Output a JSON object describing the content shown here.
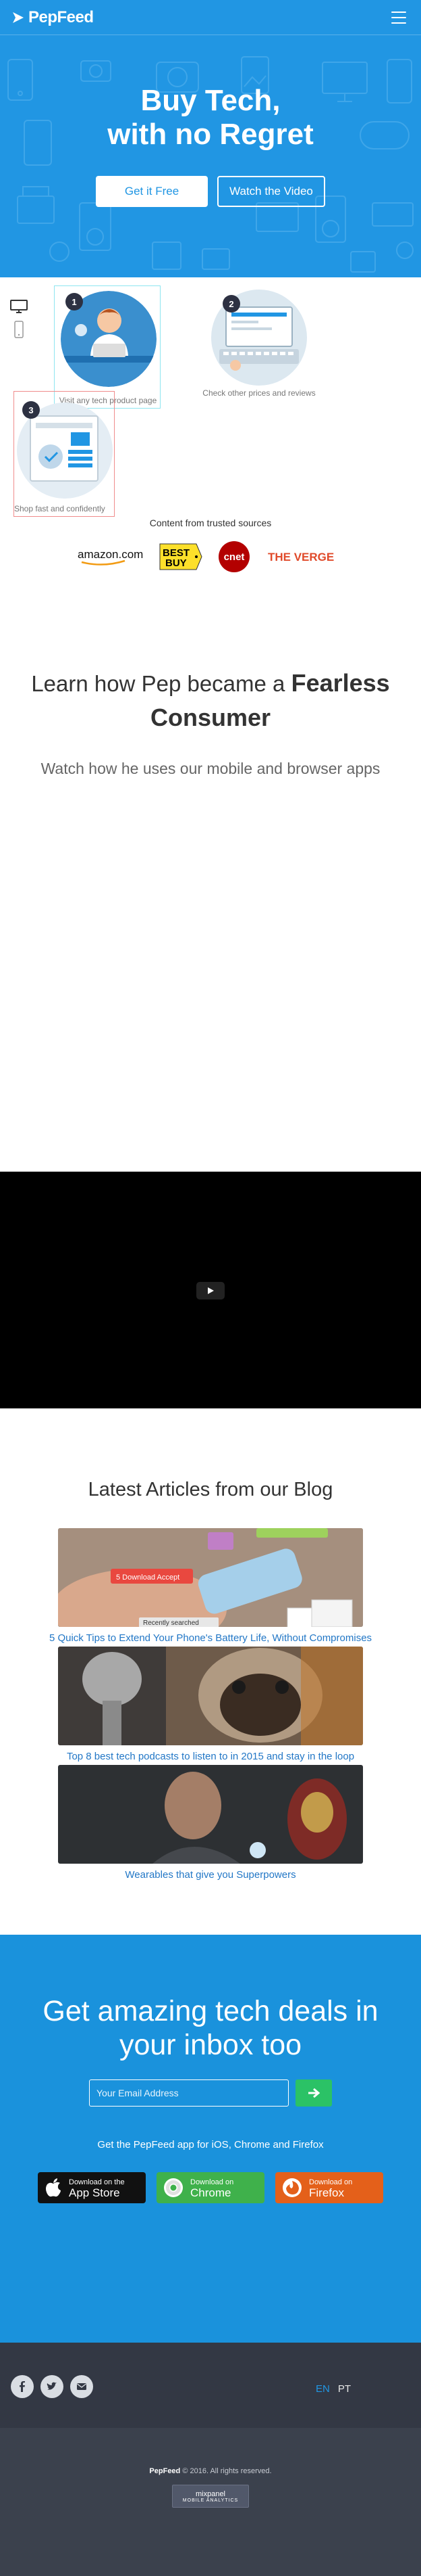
{
  "brand": {
    "name": "PepFeed"
  },
  "hero": {
    "title_line1": "Buy Tech,",
    "title_line2": "with no Regret",
    "cta_primary": "Get it Free",
    "cta_secondary": "Watch the Video"
  },
  "steps": [
    {
      "number": "1",
      "caption": "Visit any tech product page"
    },
    {
      "number": "2",
      "caption": "Check other prices and reviews"
    },
    {
      "number": "3",
      "caption": "Shop fast and confidently"
    }
  ],
  "trusted": {
    "heading": "Content from trusted sources",
    "sources": [
      "amazon.com",
      "BEST BUY",
      "cnet",
      "THE VERGE"
    ]
  },
  "story": {
    "title_plain": "Learn how Pep became a",
    "title_bold_1": "Fearless",
    "title_bold_2": "Consumer",
    "subtitle": "Watch how he uses our mobile and browser apps"
  },
  "blog": {
    "heading": "Latest Articles from our Blog",
    "articles": [
      {
        "title": "5 Quick Tips to Extend Your Phone's Battery Life, Without Compromises",
        "overlay_1": "5 Download Accept",
        "overlay_2": "Recently searched"
      },
      {
        "title": "Top 8 best tech podcasts to listen to in 2015 and stay in the loop"
      },
      {
        "title": "Wearables that give you Superpowers"
      }
    ]
  },
  "newsletter": {
    "title_line1": "Get amazing tech deals in",
    "title_line2": "your inbox too",
    "email_placeholder": "Your Email Address",
    "get_app_text": "Get the PepFeed app for iOS, Chrome and Firefox",
    "stores": [
      {
        "small": "Download on the",
        "big": "App Store"
      },
      {
        "small": "Download on",
        "big": "Chrome"
      },
      {
        "small": "Download on",
        "big": "Firefox"
      }
    ]
  },
  "footer": {
    "languages": [
      "EN",
      "PT"
    ],
    "copyright_brand": "PepFeed",
    "copyright_rest": " © 2016. All rights reserved.",
    "mixpanel_line1": "mixpanel",
    "mixpanel_line2": "MOBILE ANALYTICS"
  },
  "colors": {
    "hero_blue": "#2196e3",
    "newsletter_blue": "#1a92dc",
    "link_blue": "#2277c6",
    "go_green": "#2bc266",
    "footer_dark": "#333844"
  },
  "icons": [
    "menu-icon",
    "play-icon",
    "arrow-right-icon",
    "apple-icon",
    "chrome-icon",
    "firefox-icon",
    "facebook-icon",
    "twitter-icon",
    "mail-icon"
  ]
}
